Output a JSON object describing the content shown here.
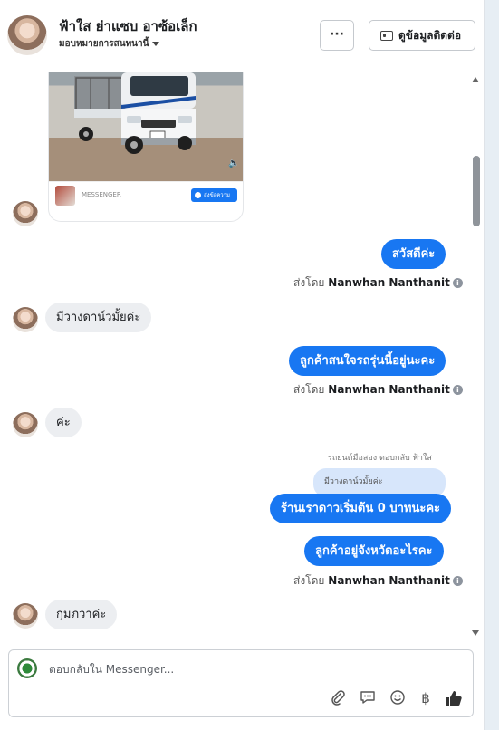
{
  "header": {
    "name": "ฟ้าใส ย่าแซบ อาซ้อเล็ก",
    "subtitle": "มอบหมายการสนทนานี้",
    "more_label": "···",
    "contact_label": "ดูข้อมูลติดต่อ"
  },
  "media_card": {
    "footer_label": "MESSENGER",
    "button_label": "ส่งข้อความ"
  },
  "messages": [
    {
      "id": "m1",
      "direction": "out",
      "text": "สวัสดีค่ะ",
      "sent_by_prefix": "ส่งโดย",
      "sent_by": "Nanwhan Nanthanit"
    },
    {
      "id": "m2",
      "direction": "in",
      "text": "มีวางดาน์วมั้ยค่ะ"
    },
    {
      "id": "m3",
      "direction": "out",
      "text": "ลูกค้าสนใจรถรุ่นนี้อยู่นะคะ",
      "sent_by_prefix": "ส่งโดย",
      "sent_by": "Nanwhan Nanthanit"
    },
    {
      "id": "m4",
      "direction": "in",
      "text": "ค่ะ"
    },
    {
      "id": "m5",
      "direction": "out",
      "reply_meta": "รถยนต์มือสอง ตอบกลับ ฟ้าใส",
      "reply_quote": "มีวางดาน์วมั้ยค่ะ",
      "text": "ร้านเราดาวเริ่มต้น 0 บาทนะคะ"
    },
    {
      "id": "m6",
      "direction": "out",
      "text": "ลูกค้าอยู่จังหวัดอะไรคะ",
      "sent_by_prefix": "ส่งโดย",
      "sent_by": "Nanwhan Nanthanit"
    },
    {
      "id": "m7",
      "direction": "in",
      "text": "กุมภวาค่ะ"
    }
  ],
  "composer": {
    "placeholder": "ตอบกลับใน Messenger..."
  },
  "icons": {
    "info": "i",
    "baht": "฿"
  },
  "colors": {
    "accent": "#1877f2",
    "incoming_bubble": "#eceef1",
    "quote_bubble": "#d7e6fb"
  }
}
